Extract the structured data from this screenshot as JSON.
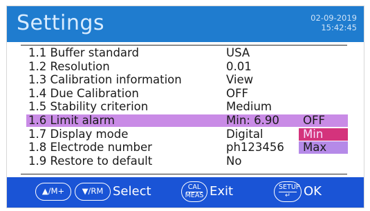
{
  "header": {
    "title": "Settings",
    "date": "02-09-2019",
    "time": "15:42:45"
  },
  "menu": [
    {
      "label": "1.1 Buffer standard",
      "value": "USA"
    },
    {
      "label": "1.2 Resolution",
      "value": "0.01"
    },
    {
      "label": "1.3 Calibration information",
      "value": "View"
    },
    {
      "label": "1.4 Due Calibration",
      "value": "OFF"
    },
    {
      "label": "1.5 Stability criterion",
      "value": "Medium"
    },
    {
      "label": "1.6 Limit alarm",
      "value": "Min: 6.90",
      "option": "OFF"
    },
    {
      "label": "1.7 Display mode",
      "value": "Digital",
      "option": "Min"
    },
    {
      "label": "1.8 Electrode number",
      "value": "ph123456",
      "option": "Max"
    },
    {
      "label": "1.9 Restore to default",
      "value": "No"
    }
  ],
  "footer": {
    "up_key": "▲/M+",
    "down_key": "▼/RM",
    "select_label": "Select",
    "cal_key_top": "CAL",
    "cal_key_bottom": "MEAS",
    "exit_label": "Exit",
    "setup_key_top": "SETUP",
    "setup_key_bottom": "↵",
    "ok_label": "OK"
  },
  "colors": {
    "title_bar": "#1f7ccf",
    "highlight": "#c98be6",
    "option_selected": "#d4337c",
    "option_max": "#b58ae8",
    "footer_bar": "#1a54d6"
  }
}
